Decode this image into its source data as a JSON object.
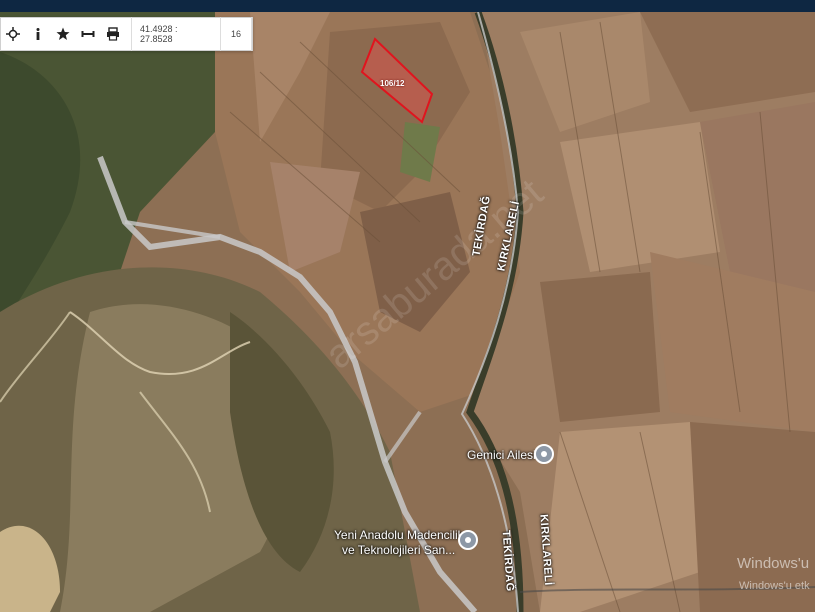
{
  "toolbar": {
    "coords": "41.4928 : 27.8528",
    "zoom": "16",
    "buttons": [
      {
        "name": "locate-icon"
      },
      {
        "name": "info-icon"
      },
      {
        "name": "star-icon"
      },
      {
        "name": "measure-icon"
      },
      {
        "name": "print-icon"
      }
    ]
  },
  "map": {
    "parcel_label": "106/12",
    "watermark": "arsaburada.net",
    "roads": [
      {
        "id": "road-label-tekirdag-1",
        "text": "TEKİRDAĞ"
      },
      {
        "id": "road-label-kirklareli-1",
        "text": "KIRKLARELİ"
      },
      {
        "id": "road-label-tekirdag-2",
        "text": "TEKİRDAĞ"
      },
      {
        "id": "road-label-kirklareli-2",
        "text": "KIRKLARELİ"
      }
    ],
    "pois": [
      {
        "id": "poi-gemici",
        "label": "Gemici Ailesi"
      },
      {
        "id": "poi-yeni-anadolu",
        "line1": "Yeni Anadolu Madencilik",
        "line2": "ve Teknolojileri San..."
      }
    ]
  },
  "os_overlay": {
    "line1": "Windows'u",
    "line2": "Windows'u etk"
  },
  "colors": {
    "parcel_fill": "#d9534f",
    "parcel_stroke": "#e0141e",
    "toolbar_bg": "#ffffff",
    "topbar": "#0e2742"
  }
}
